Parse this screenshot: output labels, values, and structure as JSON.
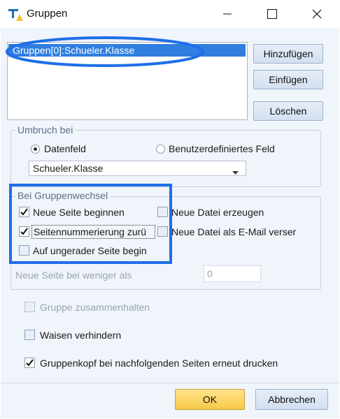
{
  "window": {
    "title": "Gruppen",
    "icon": "report-group-icon"
  },
  "groups_list": {
    "items": [
      "Gruppen[0]:Schueler.Klasse"
    ]
  },
  "buttons": {
    "add": "Hinzufügen",
    "insert": "Einfügen",
    "delete": "Löschen",
    "ok": "OK",
    "cancel": "Abbrechen"
  },
  "break_on": {
    "title": "Umbruch bei",
    "option_data_field": "Datenfeld",
    "option_custom_field": "Benutzerdefiniertes Feld",
    "selected_option": "Datenfeld",
    "field_value": "Schueler.Klasse"
  },
  "group_change": {
    "title": "Bei Gruppenwechsel",
    "new_page": "Neue Seite beginnen",
    "new_page_checked": true,
    "page_numbering": "Seitennummerierung zurü",
    "page_numbering_checked": true,
    "odd_page": "Auf ungerader Seite begin",
    "odd_page_checked": false,
    "new_file": "Neue Datei erzeugen",
    "new_file_checked": false,
    "email_file": "Neue Datei als E-Mail verser",
    "email_file_checked": false,
    "min_rows_label": "Neue Seite bei weniger als",
    "min_rows_value": "0"
  },
  "options": {
    "keep_together": "Gruppe zusammenhalten",
    "keep_together_checked": false,
    "prevent_orphans": "Waisen verhindern",
    "prevent_orphans_checked": false,
    "reprint_header": "Gruppenkopf bei nachfolgenden Seiten erneut drucken",
    "reprint_header_checked": true
  },
  "colors": {
    "annotation": "#1e6fe8",
    "selection": "#2f7ee0",
    "ok_button": "#f8c948"
  }
}
